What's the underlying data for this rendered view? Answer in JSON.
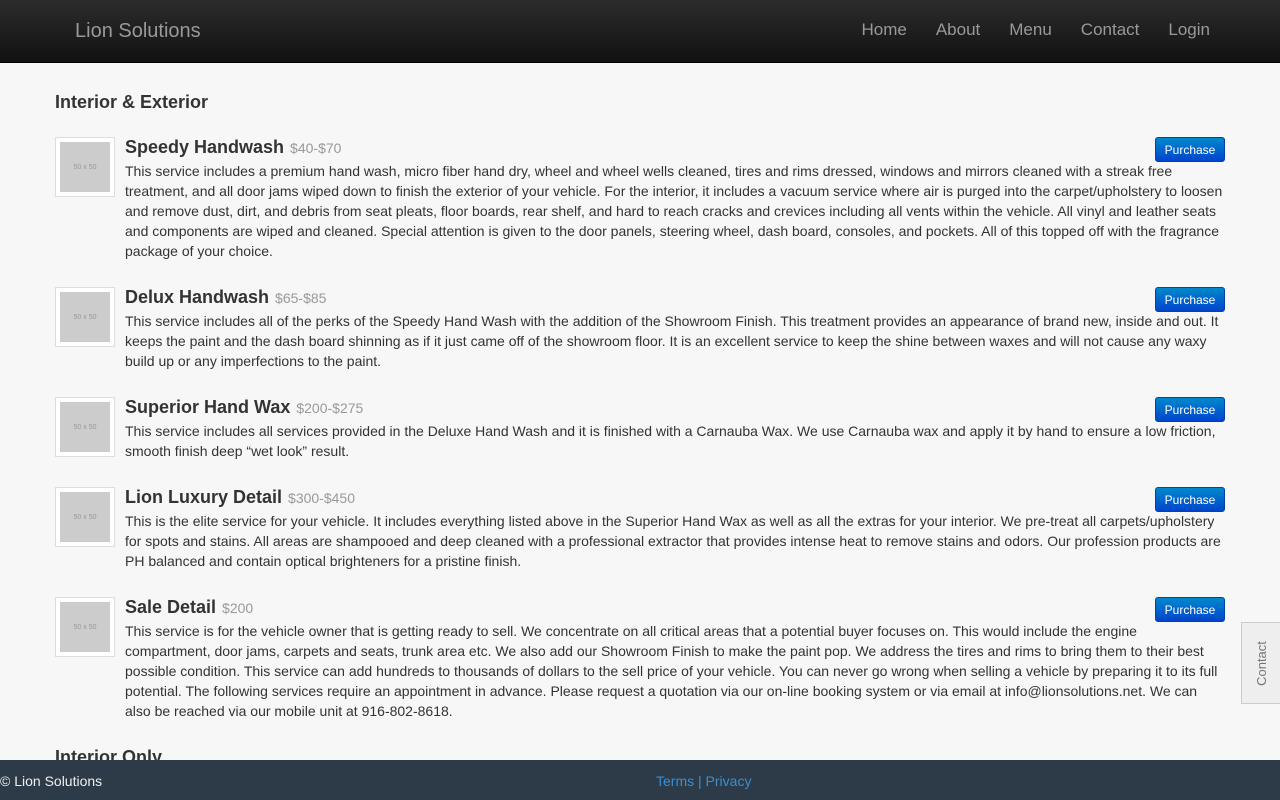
{
  "brand": "Lion Solutions",
  "nav": [
    "Home",
    "About",
    "Menu",
    "Contact",
    "Login"
  ],
  "section_title": "Interior & Exterior",
  "next_section_title": "Interior Only",
  "thumb_label": "50 x 50",
  "purchase_label": "Purchase",
  "items": [
    {
      "title": "Speedy Handwash",
      "price": "$40-$70",
      "desc": "This service includes a premium hand wash, micro fiber hand dry, wheel and wheel wells cleaned, tires and rims dressed, windows and mirrors cleaned with a streak free treatment, and all door jams wiped down to finish the exterior of your vehicle. For the interior, it includes a vacuum service where air is purged into the carpet/upholstery to loosen and remove dust, dirt, and debris from seat pleats, floor boards, rear shelf, and hard to reach cracks and crevices including all vents within the vehicle. All vinyl and leather seats and components are wiped and cleaned. Special attention is given to the door panels, steering wheel, dash board, consoles, and pockets. All of this topped off with the fragrance package of your choice."
    },
    {
      "title": "Delux Handwash",
      "price": "$65-$85",
      "desc": "This service includes all of the perks of the Speedy Hand Wash with the addition of the Showroom Finish. This treatment provides an appearance of brand new, inside and out. It keeps the paint and the dash board shinning as if it just came off of the showroom floor. It is an excellent service to keep the shine between waxes and will not cause any waxy build up or any imperfections to the paint."
    },
    {
      "title": "Superior Hand Wax",
      "price": "$200-$275",
      "desc": "This service includes all services provided in the Deluxe Hand Wash and it is finished with a Carnauba Wax. We use Carnauba wax and apply it by hand to ensure a low friction, smooth finish deep “wet look” result."
    },
    {
      "title": "Lion Luxury Detail",
      "price": "$300-$450",
      "desc": "This is the elite service for your vehicle. It includes everything listed above in the Superior Hand Wax as well as all the extras for your interior. We pre-treat all carpets/upholstery for spots and stains. All areas are shampooed and deep cleaned with a professional extractor that provides intense heat to remove stains and odors. Our profession products are PH balanced and contain optical brighteners for a pristine finish."
    },
    {
      "title": "Sale Detail",
      "price": "$200",
      "desc": "This service is for the vehicle owner that is getting ready to sell. We concentrate on all critical areas that a potential buyer focuses on. This would include the engine compartment, door jams, carpets and seats, trunk area etc. We also add our Showroom Finish to make the paint pop. We address the tires and rims to bring them to their best possible condition. This service can add hundreds to thousands of dollars to the sell price of your vehicle. You can never go wrong when selling a vehicle by preparing it to its full potential. The following services require an appointment in advance. Please request a quotation via our on-line booking system or via email at info@lionsolutions.net. We can also be reached via our mobile unit at 916-802-8618."
    }
  ],
  "contact_tab": "Contact",
  "footer": {
    "copyright": "© Lion Solutions",
    "terms": "Terms",
    "separator": "|",
    "privacy": "Privacy"
  }
}
